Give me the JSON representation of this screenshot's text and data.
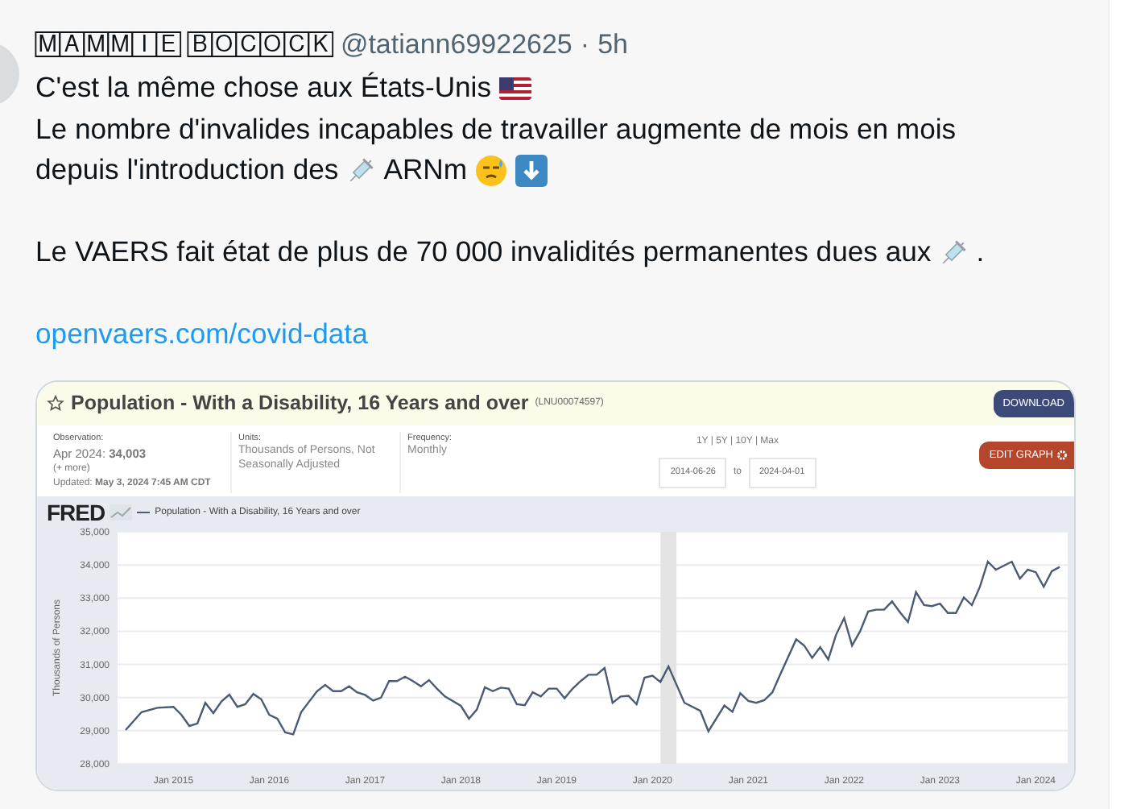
{
  "author": {
    "display_name": "🄼🄰🄼🄼🄸🄴 🄱🄾🄲🄾🄲🄺",
    "handle": "@tatiann69922625",
    "separator": "·",
    "time": "5h"
  },
  "tweet": {
    "paragraphs": [
      [
        [
          {
            "kind": "text",
            "text": "C'est la même chose aux États-Unis"
          },
          {
            "kind": "flag"
          }
        ],
        [
          {
            "kind": "text",
            "text": "Le nombre d'invalides incapables de travailler augmente de mois en mois"
          }
        ],
        [
          {
            "kind": "text",
            "text": "depuis l'introduction des"
          },
          {
            "kind": "syringe"
          },
          {
            "kind": "text",
            "text": "ARNm"
          },
          {
            "kind": "face"
          },
          {
            "kind": "down-arrow"
          }
        ]
      ],
      [
        [
          {
            "kind": "text",
            "text": "Le VAERS fait état de plus de 70 000 invalidités permanentes dues aux"
          },
          {
            "kind": "syringe"
          },
          {
            "kind": "text",
            "text": "."
          }
        ]
      ],
      [
        [
          {
            "kind": "link",
            "text": "openvaers.com/covid-data"
          }
        ]
      ]
    ]
  },
  "image": {
    "title": "Population - With a Disability, 16 Years and over",
    "series_id": "(LNU00074597)",
    "download": "DOWNLOAD",
    "observation": {
      "label": "Observation:",
      "value": "Apr 2024: **34,003**",
      "more": "(+ more)",
      "updated": "Updated: **May 3, 2024 7:45 AM CDT**"
    },
    "units": {
      "label": "Units:",
      "value": "Thousands of Persons, Not Seasonally Adjusted"
    },
    "frequency": {
      "label": "Frequency:",
      "value": "Monthly"
    },
    "ranges": "1Y | 5Y | 10Y | Max",
    "date_from": "2014-06-26",
    "date_to_label": "to",
    "date_to": "2024-04-01",
    "edit_graph": "EDIT GRAPH",
    "logo": "FRED",
    "chart_data": {
      "type": "line",
      "grid": true,
      "bands": [
        {
          "axis": "x",
          "from": "2020-02-01",
          "to": "2020-04-01"
        }
      ],
      "ylabel": "Thousands of Persons",
      "xlim": [
        "2014-06",
        "2024-05"
      ],
      "ylim": [
        28000,
        35000
      ],
      "yticks": [
        {
          "value": 28000,
          "label": "28,000"
        },
        {
          "value": 29000,
          "label": "29,000"
        },
        {
          "value": 30000,
          "label": "30,000"
        },
        {
          "value": 31000,
          "label": "31,000"
        },
        {
          "value": 32000,
          "label": "32,000"
        },
        {
          "value": 33000,
          "label": "33,000"
        },
        {
          "value": 34000,
          "label": "34,000"
        },
        {
          "value": 35000,
          "label": "35,000"
        }
      ],
      "xticks": [
        {
          "value": "2015-01",
          "label": "Jan 2015"
        },
        {
          "value": "2016-01",
          "label": "Jan 2016"
        },
        {
          "value": "2017-01",
          "label": "Jan 2017"
        },
        {
          "value": "2018-01",
          "label": "Jan 2018"
        },
        {
          "value": "2019-01",
          "label": "Jan 2019"
        },
        {
          "value": "2020-01",
          "label": "Jan 2020"
        },
        {
          "value": "2021-01",
          "label": "Jan 2021"
        },
        {
          "value": "2022-01",
          "label": "Jan 2022"
        },
        {
          "value": "2023-01",
          "label": "Jan 2023"
        },
        {
          "value": "2024-01",
          "label": "Jan 2024"
        }
      ],
      "x": [
        "2014-07",
        "2014-09",
        "2014-11",
        "2015-01",
        "2015-02",
        "2015-03",
        "2015-04",
        "2015-05",
        "2015-06",
        "2015-07",
        "2015-08",
        "2015-09",
        "2015-10",
        "2015-11",
        "2015-12",
        "2016-01",
        "2016-02",
        "2016-03",
        "2016-04",
        "2016-05",
        "2016-06",
        "2016-07",
        "2016-08",
        "2016-09",
        "2016-10",
        "2016-11",
        "2016-12",
        "2017-01",
        "2017-02",
        "2017-03",
        "2017-04",
        "2017-05",
        "2017-06",
        "2017-07",
        "2017-08",
        "2017-09",
        "2017-10",
        "2017-11",
        "2018-01",
        "2018-02",
        "2018-03",
        "2018-04",
        "2018-05",
        "2018-06",
        "2018-07",
        "2018-08",
        "2018-09",
        "2018-10",
        "2018-11",
        "2018-12",
        "2019-01",
        "2019-02",
        "2019-03",
        "2019-04",
        "2019-05",
        "2019-06",
        "2019-07",
        "2019-08",
        "2019-09",
        "2019-10",
        "2019-11",
        "2019-12",
        "2020-01",
        "2020-02",
        "2020-03",
        "2020-05",
        "2020-07",
        "2020-08",
        "2020-10",
        "2020-11",
        "2020-12",
        "2021-01",
        "2021-02",
        "2021-03",
        "2021-04",
        "2021-05",
        "2021-07",
        "2021-08",
        "2021-09",
        "2021-10",
        "2021-11",
        "2021-12",
        "2022-01",
        "2022-02",
        "2022-03",
        "2022-04",
        "2022-05",
        "2022-06",
        "2022-07",
        "2022-08",
        "2022-09",
        "2022-10",
        "2022-11",
        "2022-12",
        "2023-01",
        "2023-02",
        "2023-03",
        "2023-04",
        "2023-05",
        "2023-06",
        "2023-07",
        "2023-08",
        "2023-10",
        "2023-11",
        "2023-12",
        "2024-01",
        "2024-02",
        "2024-03",
        "2024-04"
      ],
      "series": [
        {
          "name": "Population - With a Disability, 16 Years and over",
          "color": "#4c5a74",
          "values": [
            29020,
            29560,
            29690,
            29720,
            29480,
            29140,
            29220,
            29840,
            29530,
            29880,
            30090,
            29720,
            29800,
            30110,
            29950,
            29480,
            29360,
            28950,
            28890,
            29560,
            29880,
            30190,
            30380,
            30190,
            30190,
            30340,
            30160,
            30080,
            29910,
            30000,
            30500,
            30500,
            30630,
            30500,
            30340,
            30530,
            30270,
            30030,
            29750,
            29360,
            29640,
            30310,
            30190,
            30300,
            30270,
            29800,
            29770,
            30160,
            30030,
            30270,
            30270,
            29980,
            30270,
            30500,
            30690,
            30690,
            30890,
            29840,
            30030,
            30050,
            29800,
            30600,
            30660,
            30470,
            30940,
            29840,
            29600,
            28980,
            29760,
            29570,
            30130,
            29900,
            29840,
            29920,
            30160,
            30700,
            31760,
            31570,
            31200,
            31520,
            31150,
            31900,
            32400,
            31570,
            32000,
            32600,
            32650,
            32650,
            32900,
            32570,
            32280,
            33180,
            32790,
            32760,
            32830,
            32550,
            32550,
            33020,
            32790,
            33340,
            34100,
            33860,
            34100,
            33590,
            33860,
            33780,
            33340,
            33810,
            33940
          ]
        }
      ]
    }
  }
}
